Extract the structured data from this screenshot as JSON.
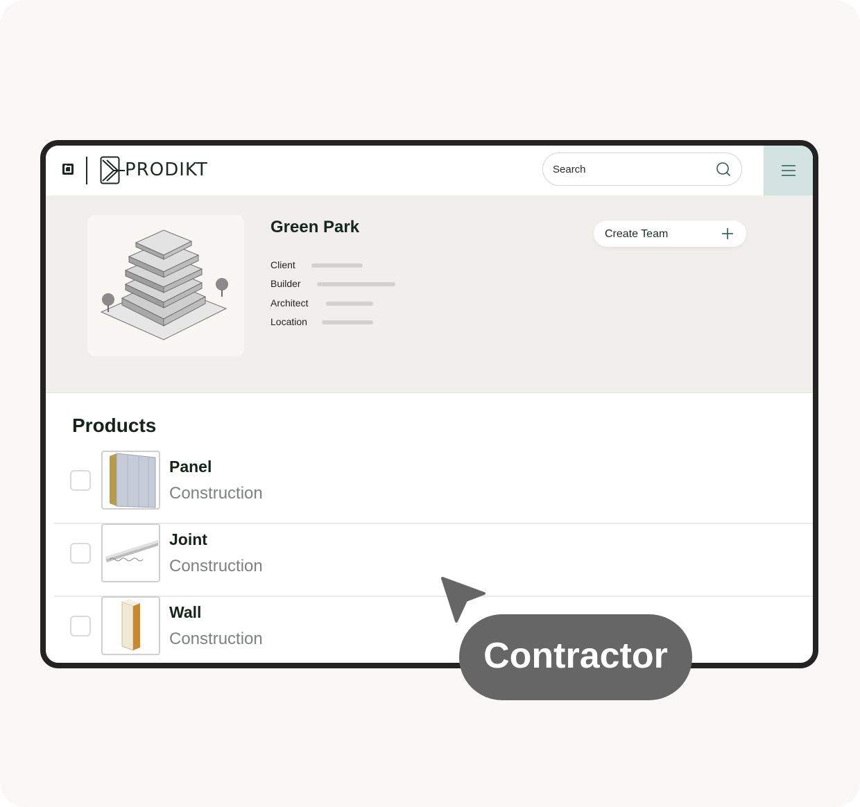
{
  "header": {
    "brand_name": "PRODIKT",
    "search": {
      "placeholder": "Search"
    },
    "icons": [
      "bimobject-logo-icon",
      "prodikt-logo-icon",
      "search-icon",
      "hamburger-menu-icon"
    ]
  },
  "project": {
    "title": "Green Park",
    "fields": [
      {
        "label": "Client"
      },
      {
        "label": "Builder"
      },
      {
        "label": "Architect"
      },
      {
        "label": "Location"
      }
    ],
    "create_team_label": "Create Team"
  },
  "products": {
    "title": "Products",
    "items": [
      {
        "name": "Panel",
        "category": "Construction",
        "checked": false
      },
      {
        "name": "Joint",
        "category": "Construction",
        "checked": false
      },
      {
        "name": "Wall",
        "category": "Construction",
        "checked": false
      }
    ]
  },
  "overlay": {
    "role_label": "Contractor",
    "cursor_icon": "cursor-arrow-icon"
  },
  "colors": {
    "brand_dark": "#1c2a22",
    "menu_bg": "#d3e3e2",
    "project_bg": "#f1efeb",
    "pill_bg": "#666666"
  }
}
